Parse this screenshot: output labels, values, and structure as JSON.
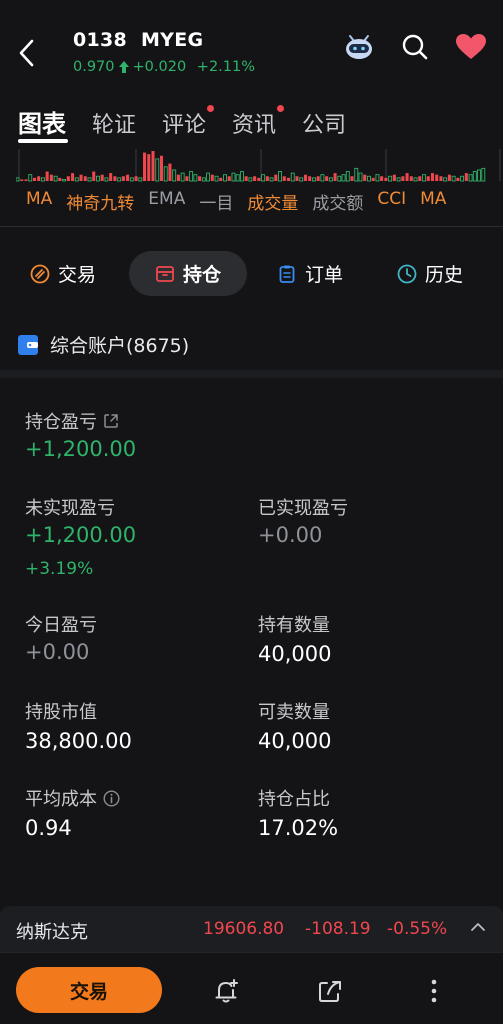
{
  "header": {
    "code": "0138",
    "name": "MYEG",
    "price": "0.970",
    "change": "+0.020",
    "change_pct": "+2.11%"
  },
  "tabs": [
    {
      "label": "图表",
      "active": true,
      "dot": false
    },
    {
      "label": "轮证",
      "active": false,
      "dot": false
    },
    {
      "label": "评论",
      "active": false,
      "dot": true
    },
    {
      "label": "资讯",
      "active": false,
      "dot": true
    },
    {
      "label": "公司",
      "active": false,
      "dot": false
    }
  ],
  "indicators": [
    {
      "label": "MA",
      "highlight": true
    },
    {
      "label": "神奇九转",
      "highlight": true
    },
    {
      "label": "EMA",
      "highlight": false
    },
    {
      "label": "一目",
      "highlight": false
    },
    {
      "label": "成交量",
      "highlight": true
    },
    {
      "label": "成交额",
      "highlight": false
    },
    {
      "label": "CCI",
      "highlight": true
    },
    {
      "label": "MA",
      "highlight": true
    }
  ],
  "volume_bars": {
    "values": [
      2,
      1,
      1,
      4,
      2,
      3,
      2,
      6,
      4,
      3,
      2,
      1,
      3,
      5,
      2,
      4,
      3,
      2,
      6,
      3,
      4,
      2,
      5,
      3,
      2,
      3,
      4,
      2,
      3,
      2,
      18,
      17,
      19,
      14,
      16,
      9,
      11,
      7,
      4,
      5,
      3,
      6,
      4,
      3,
      2,
      5,
      4,
      3,
      2,
      4,
      3,
      5,
      4,
      6,
      3,
      2,
      3,
      2,
      4,
      3,
      2,
      4,
      6,
      3,
      2,
      5,
      3,
      2,
      4,
      3,
      2,
      3,
      4,
      3,
      2,
      5,
      3,
      4,
      6,
      3,
      8,
      5,
      4,
      3,
      2,
      4,
      3,
      2,
      3,
      4,
      2,
      3,
      5,
      3,
      2,
      3,
      4,
      3,
      5,
      4,
      3,
      2,
      4,
      3,
      2,
      3,
      5,
      4,
      6,
      7,
      8
    ],
    "colors": [
      "g",
      "r",
      "r",
      "g",
      "r",
      "r",
      "g",
      "r",
      "r",
      "g",
      "r",
      "g",
      "r",
      "r",
      "g",
      "r",
      "r",
      "g",
      "r",
      "g",
      "r",
      "g",
      "r",
      "r",
      "g",
      "r",
      "r",
      "g",
      "r",
      "g",
      "r",
      "r",
      "r",
      "g",
      "r",
      "g",
      "r",
      "g",
      "r",
      "g",
      "r",
      "g",
      "g",
      "r",
      "g",
      "g",
      "r",
      "g",
      "r",
      "g",
      "r",
      "g",
      "g",
      "g",
      "r",
      "g",
      "r",
      "r",
      "g",
      "r",
      "g",
      "r",
      "g",
      "r",
      "r",
      "g",
      "r",
      "g",
      "r",
      "r",
      "g",
      "r",
      "g",
      "r",
      "g",
      "r",
      "g",
      "g",
      "g",
      "r",
      "g",
      "g",
      "r",
      "g",
      "r",
      "g",
      "r",
      "r",
      "g",
      "r",
      "g",
      "r",
      "r",
      "r",
      "g",
      "r",
      "g",
      "r",
      "r",
      "r",
      "r",
      "g",
      "r",
      "g",
      "r",
      "g",
      "r",
      "g",
      "g",
      "g",
      "g",
      "g"
    ]
  },
  "segments": [
    {
      "label": "交易",
      "icon": "trade-icon",
      "active": false
    },
    {
      "label": "持仓",
      "icon": "position-box-icon",
      "active": true
    },
    {
      "label": "订单",
      "icon": "clipboard-icon",
      "active": false
    },
    {
      "label": "历史",
      "icon": "clock-icon",
      "active": false
    }
  ],
  "account": {
    "label": "综合账户(8675)"
  },
  "position": {
    "pnl_label": "持仓盈亏",
    "pnl_value": "+1,200.00",
    "unrealized_label": "未实现盈亏",
    "unrealized_value": "+1,200.00",
    "unrealized_pct": "+3.19%",
    "realized_label": "已实现盈亏",
    "realized_value": "+0.00",
    "today_label": "今日盈亏",
    "today_value": "+0.00",
    "qty_label": "持有数量",
    "qty_value": "40,000",
    "mktval_label": "持股市值",
    "mktval_value": "38,800.00",
    "sellable_label": "可卖数量",
    "sellable_value": "40,000",
    "avgcost_label": "平均成本",
    "avgcost_value": "0.94",
    "ratio_label": "持仓占比",
    "ratio_value": "17.02%"
  },
  "index": {
    "name": "纳斯达克",
    "value": "19606.80",
    "change": "-108.19",
    "change_pct": "-0.55%"
  },
  "bottom": {
    "trade_label": "交易"
  },
  "colors": {
    "up": "#2fb36a",
    "down": "#f0474e",
    "accent": "#f27a1c",
    "fav": "#f2566a"
  }
}
